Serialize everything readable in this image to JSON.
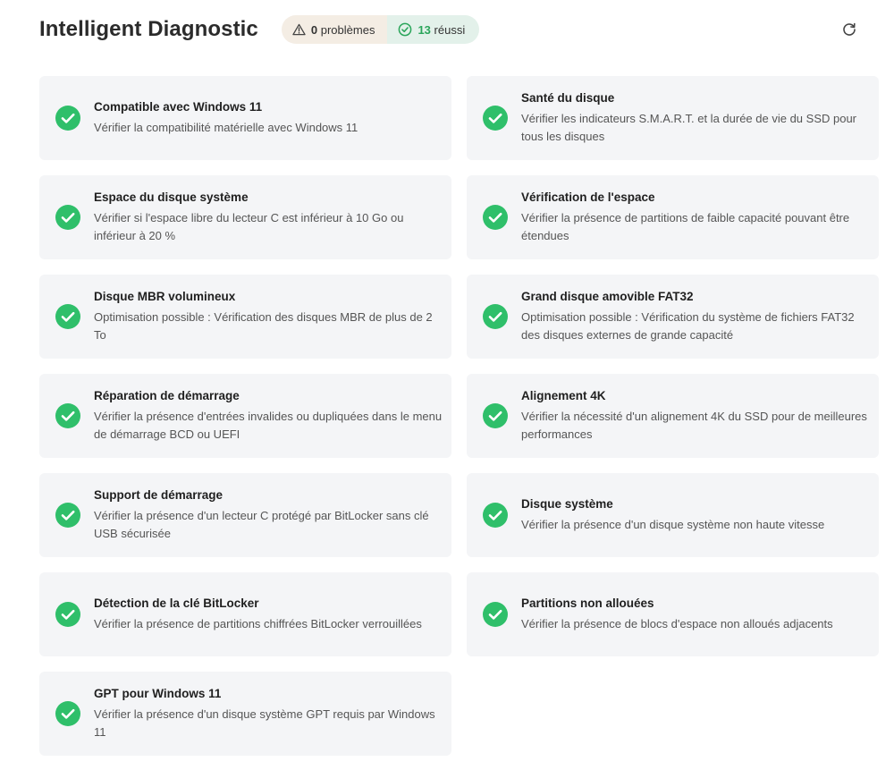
{
  "header": {
    "title": "Intelligent Diagnostic",
    "problems_count": "0",
    "problems_label": "problèmes",
    "passed_count": "13",
    "passed_label": "réussi"
  },
  "colors": {
    "success": "#2fbf6a",
    "card_bg": "#f4f5f7",
    "warn_pill_bg": "#f4ede4",
    "ok_pill_bg": "#e3f1ea"
  },
  "icons": {
    "warning": "warning-triangle-icon",
    "passed": "check-circle-icon",
    "refresh": "refresh-icon",
    "item_status": "check-circle-icon"
  },
  "checks": [
    {
      "title": "Compatible avec Windows 11",
      "desc": "Vérifier la compatibilité matérielle avec Windows 11"
    },
    {
      "title": "Santé du disque",
      "desc": "Vérifier les indicateurs S.M.A.R.T. et la durée de vie du SSD pour tous les disques"
    },
    {
      "title": "Espace du disque système",
      "desc": "Vérifier si l'espace libre du lecteur C est inférieur à 10 Go ou inférieur à 20 %"
    },
    {
      "title": "Vérification de l'espace",
      "desc": "Vérifier la présence de partitions de faible capacité pouvant être étendues"
    },
    {
      "title": "Disque MBR volumineux",
      "desc": "Optimisation possible : Vérification des disques MBR de plus de 2 To"
    },
    {
      "title": "Grand disque amovible FAT32",
      "desc": "Optimisation possible : Vérification du système de fichiers FAT32 des disques externes de grande capacité"
    },
    {
      "title": "Réparation de démarrage",
      "desc": "Vérifier la présence d'entrées invalides ou dupliquées dans le menu de démarrage BCD ou UEFI"
    },
    {
      "title": "Alignement 4K",
      "desc": "Vérifier la nécessité d'un alignement 4K du SSD pour de meilleures performances"
    },
    {
      "title": "Support de démarrage",
      "desc": "Vérifier la présence d'un lecteur C protégé par BitLocker sans clé USB sécurisée"
    },
    {
      "title": "Disque système",
      "desc": "Vérifier la présence d'un disque système non haute vitesse"
    },
    {
      "title": "Détection de la clé BitLocker",
      "desc": "Vérifier la présence de partitions chiffrées BitLocker verrouillées"
    },
    {
      "title": "Partitions non allouées",
      "desc": "Vérifier la présence de blocs d'espace non alloués adjacents"
    },
    {
      "title": "GPT pour Windows 11",
      "desc": "Vérifier la présence d'un disque système GPT requis par Windows 11"
    }
  ]
}
